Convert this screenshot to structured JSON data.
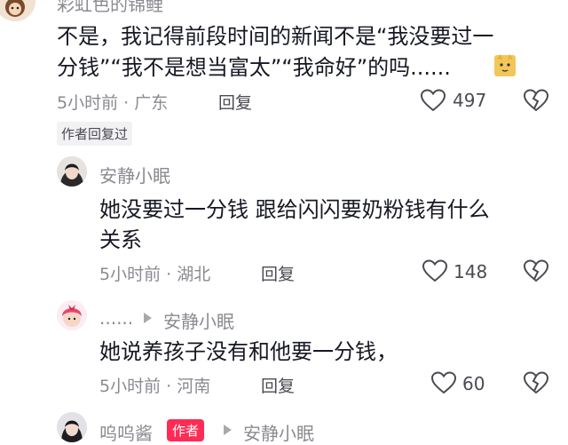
{
  "top_comment": {
    "username": "彩虹色的锦鲤",
    "text_line1": "不是，我记得前段时间的新闻不是“我没要过一",
    "text_line2": "分钱”“我不是想当富太”“我命好”的吗......",
    "emoji_icon": "cat-emoji-icon",
    "time": "5小时前 · 广东",
    "reply_label": "回复",
    "likes": "497",
    "author_replied_tag": "作者回复过"
  },
  "replies": [
    {
      "username": "安静小眠",
      "text_line1": "她没要过一分钱 跟给闪闪要奶粉钱有什么",
      "text_line2": "关系",
      "time": "5小时前 · 湖北",
      "reply_label": "回复",
      "likes": "148"
    },
    {
      "username": "......",
      "reply_to": "安静小眠",
      "text_line1": "她说养孩子没有和他要一分钱，",
      "time": "5小时前 · 河南",
      "reply_label": "回复",
      "likes": "60"
    },
    {
      "username": "呜呜酱",
      "author_badge": "作者",
      "reply_to": "安静小眠"
    }
  ],
  "colors": {
    "accent": "#fe2c55",
    "meta": "#8a8b91",
    "text": "#161823"
  }
}
